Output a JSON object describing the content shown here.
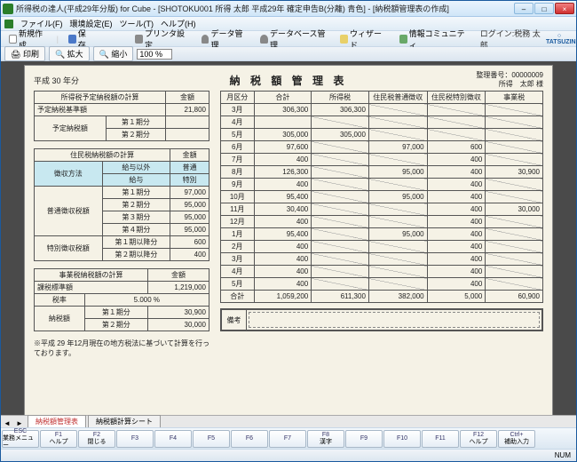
{
  "window": {
    "title": "所得税の達人(平成29年分版) for Cube - [SHOTOKU001 所得 太郎 平成29年 確定申告B(分離) 青色] - [納税額管理表の作成]"
  },
  "menu": {
    "file": "ファイル(F)",
    "env": "環境設定(E)",
    "tool": "ツール(T)",
    "help": "ヘルプ(H)"
  },
  "toolbar": {
    "new": "新規作成",
    "save": "保存",
    "print": "プリンタ設定",
    "data": "データ管理",
    "db": "データベース管理",
    "wizard": "ウィザード",
    "comm": "情報コミュニティ",
    "login": "ログイン:税務 太郎",
    "logo": "TATSUZIN"
  },
  "subtool": {
    "print": "印刷",
    "expand": "拡大",
    "shrink": "縮小",
    "zoom": "100 %"
  },
  "doc": {
    "year": "平成 30 年分",
    "title": "納 税 額 管 理 表",
    "idlabel": "整理番号：",
    "id": "00000009",
    "owner": "所得　太郎 様"
  },
  "tblA": {
    "title": "所得税予定納税額の計算",
    "amt": "金額",
    "r1": "予定納税基準額",
    "v1": "21,800",
    "r2": "予定納税額",
    "p1": "第１期分",
    "p2": "第２期分"
  },
  "tblB": {
    "title": "住民税納税額の計算",
    "amt": "金額",
    "r1": "徴収方法",
    "c1": "給与以外",
    "c1v": "普通",
    "c2": "給与",
    "c2v": "特別",
    "r2": "普通徴収税額",
    "p1": "第１期分",
    "p1v": "97,000",
    "p2": "第２期分",
    "p2v": "95,000",
    "p3": "第３期分",
    "p3v": "95,000",
    "p4": "第４期分",
    "p4v": "95,000",
    "r3": "特別徴収税額",
    "s1": "第１期以降分",
    "s1v": "600",
    "s2": "第２期以降分",
    "s2v": "400"
  },
  "tblC": {
    "title": "事業税納税額の計算",
    "amt": "金額",
    "r1": "課税標準額",
    "v1": "1,219,000",
    "r2": "税率",
    "v2": "5.000 %",
    "r3": "納税額",
    "p1": "第１期分",
    "p1v": "30,900",
    "p2": "第２期分",
    "p2v": "30,000"
  },
  "footnote": "※平成 29 年12月現在の地方税法に基づいて計算を行っております。",
  "main": {
    "hdr": {
      "m": "月区分",
      "total": "合計",
      "income": "所得税",
      "f": "住民税普通徴収",
      "t": "住民税特別徴収",
      "biz": "事業税"
    },
    "rows": [
      {
        "m": "3月",
        "total": "306,300",
        "income": "306,300",
        "f": "",
        "t": "",
        "biz": ""
      },
      {
        "m": "4月",
        "total": "",
        "income": "",
        "f": "",
        "t": "",
        "biz": ""
      },
      {
        "m": "5月",
        "total": "305,000",
        "income": "305,000",
        "f": "",
        "t": "",
        "biz": ""
      },
      {
        "m": "6月",
        "total": "97,600",
        "income": "",
        "f": "97,000",
        "t": "600",
        "biz": ""
      },
      {
        "m": "7月",
        "total": "400",
        "income": "",
        "f": "",
        "t": "400",
        "biz": ""
      },
      {
        "m": "8月",
        "total": "126,300",
        "income": "",
        "f": "95,000",
        "t": "400",
        "biz": "30,900"
      },
      {
        "m": "9月",
        "total": "400",
        "income": "",
        "f": "",
        "t": "400",
        "biz": ""
      },
      {
        "m": "10月",
        "total": "95,400",
        "income": "",
        "f": "95,000",
        "t": "400",
        "biz": ""
      },
      {
        "m": "11月",
        "total": "30,400",
        "income": "",
        "f": "",
        "t": "400",
        "biz": "30,000"
      },
      {
        "m": "12月",
        "total": "400",
        "income": "",
        "f": "",
        "t": "400",
        "biz": ""
      },
      {
        "m": "1月",
        "total": "95,400",
        "income": "",
        "f": "95,000",
        "t": "400",
        "biz": ""
      },
      {
        "m": "2月",
        "total": "400",
        "income": "",
        "f": "",
        "t": "400",
        "biz": ""
      },
      {
        "m": "3月",
        "total": "400",
        "income": "",
        "f": "",
        "t": "400",
        "biz": ""
      },
      {
        "m": "4月",
        "total": "400",
        "income": "",
        "f": "",
        "t": "400",
        "biz": ""
      },
      {
        "m": "5月",
        "total": "400",
        "income": "",
        "f": "",
        "t": "400",
        "biz": ""
      }
    ],
    "sum": {
      "m": "合計",
      "total": "1,059,200",
      "income": "611,300",
      "f": "382,000",
      "t": "5,000",
      "biz": "60,900"
    },
    "remark": "備考"
  },
  "tabs": {
    "t1": "納税額管理表",
    "t2": "納税額計算シート"
  },
  "fkeys": [
    {
      "k": "ESC",
      "l": "業務メニュー"
    },
    {
      "k": "F1",
      "l": "ヘルプ"
    },
    {
      "k": "F2",
      "l": "閉じる"
    },
    {
      "k": "F3",
      "l": ""
    },
    {
      "k": "F4",
      "l": ""
    },
    {
      "k": "F5",
      "l": ""
    },
    {
      "k": "F6",
      "l": ""
    },
    {
      "k": "F7",
      "l": ""
    },
    {
      "k": "F8",
      "l": "漢字"
    },
    {
      "k": "F9",
      "l": ""
    },
    {
      "k": "F10",
      "l": ""
    },
    {
      "k": "F11",
      "l": ""
    },
    {
      "k": "F12",
      "l": "ヘルプ"
    },
    {
      "k": "Ctrl+",
      "l": "補助入力"
    }
  ],
  "status": {
    "num": "NUM"
  }
}
